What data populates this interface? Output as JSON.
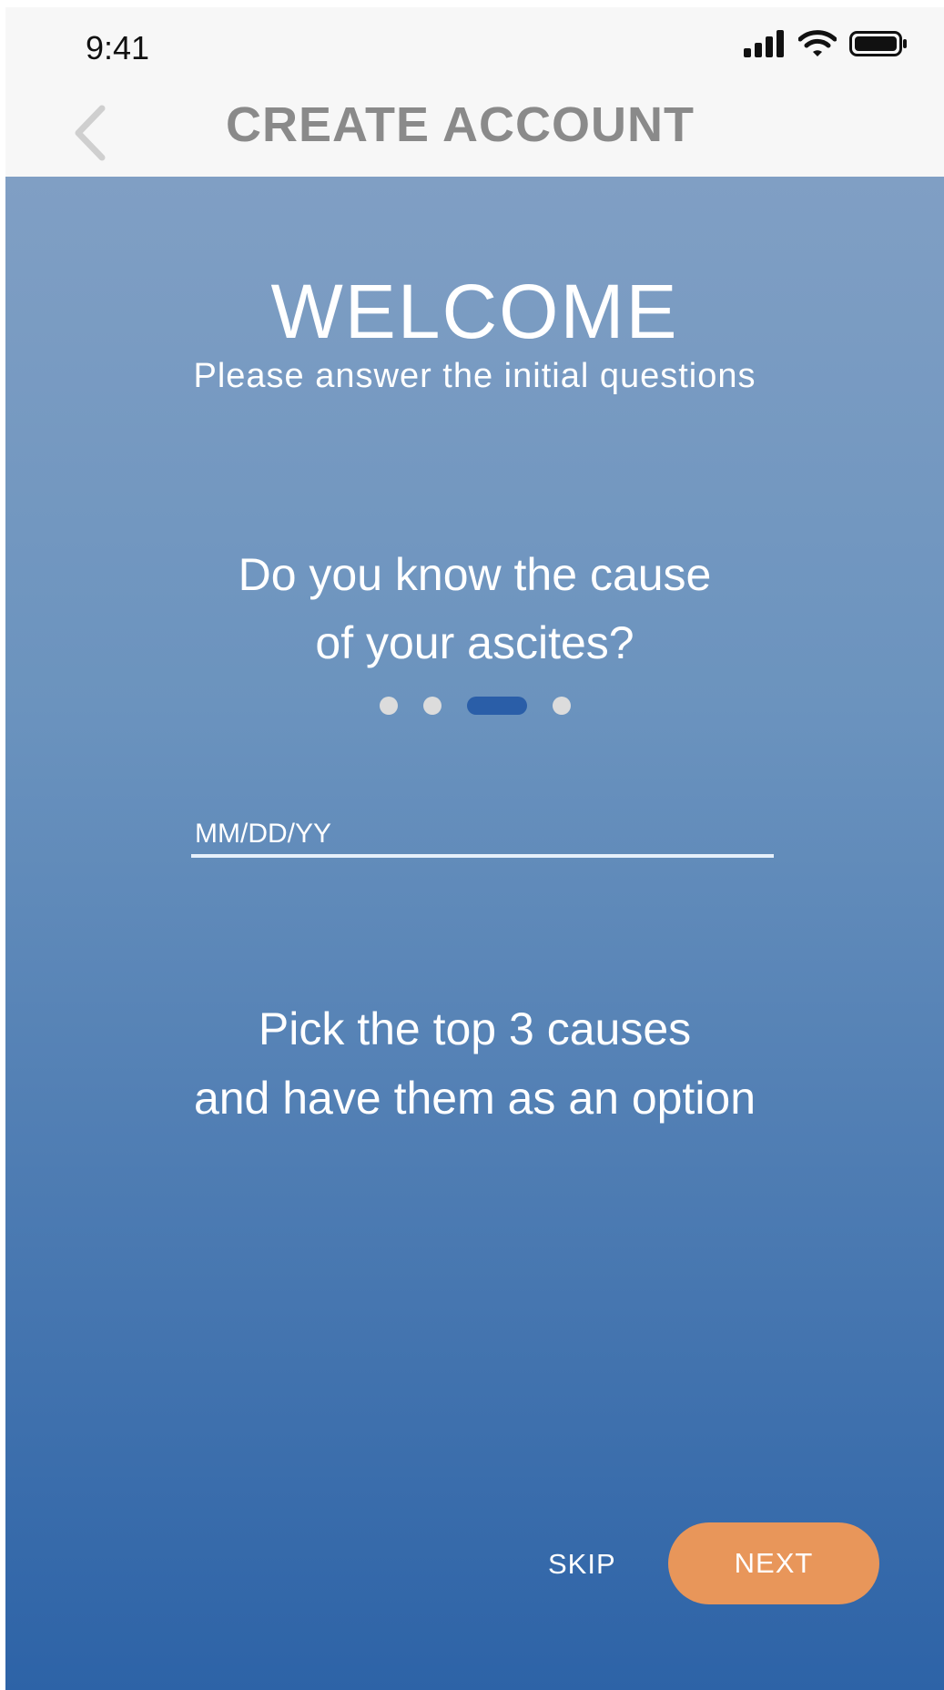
{
  "status_bar": {
    "time": "9:41",
    "icons": [
      "cellular-signal-icon",
      "wifi-icon",
      "battery-icon"
    ]
  },
  "nav": {
    "title": "CREATE ACCOUNT",
    "back_icon": "chevron-left-icon"
  },
  "welcome": {
    "title": "WELCOME",
    "subtitle": "Please answer the initial questions"
  },
  "question": {
    "line1": "Do you know the cause",
    "line2": "of your ascites?"
  },
  "pager": {
    "total": 4,
    "active_index": 2
  },
  "date_input": {
    "placeholder": "MM/DD/YY",
    "value": ""
  },
  "note": {
    "line1": "Pick the top 3 causes",
    "line2": "and have them as an option"
  },
  "actions": {
    "skip_label": "SKIP",
    "next_label": "NEXT"
  },
  "colors": {
    "gradient_top": "#809fc4",
    "gradient_bottom": "#2d63a7",
    "accent": "#e8965a",
    "pager_active": "#2a5ea8",
    "pager_inactive": "#dcdcdc",
    "nav_title": "#8a8a8a"
  }
}
